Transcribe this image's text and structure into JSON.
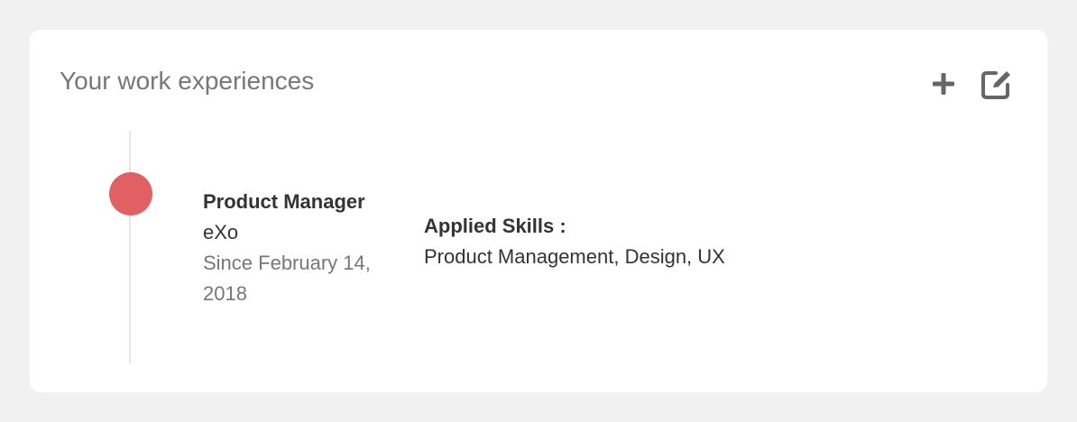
{
  "card": {
    "title": "Your work experiences",
    "actions": [
      {
        "icon": "plus-icon",
        "label": "Add"
      },
      {
        "icon": "edit-icon",
        "label": "Edit"
      }
    ]
  },
  "experience": {
    "position": "Product Manager",
    "company": "eXo",
    "since": "Since February 14, 2018",
    "skills_label": "Applied Skills :",
    "skills": "Product Management, Design, UX"
  },
  "colors": {
    "background": "#f1f1f1",
    "card": "#ffffff",
    "timeline_dot": "#e16063",
    "icon": "#666666",
    "muted_text": "#777777",
    "text": "#333333"
  }
}
